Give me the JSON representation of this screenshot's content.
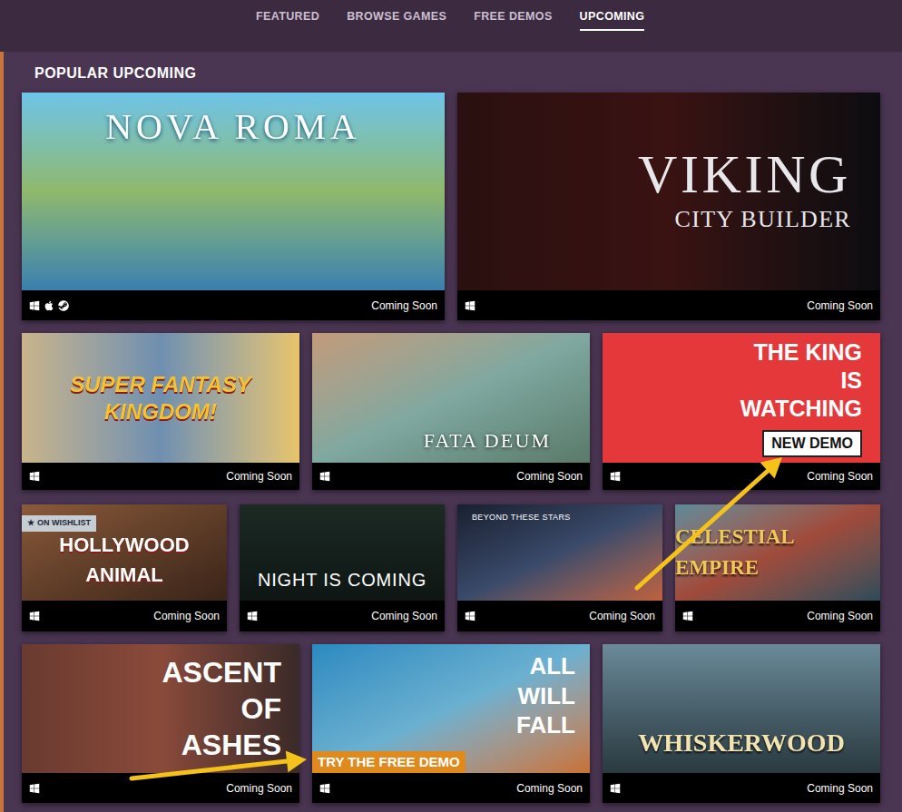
{
  "nav": {
    "tabs": [
      {
        "label": "FEATURED",
        "selected": false
      },
      {
        "label": "BROWSE GAMES",
        "selected": false
      },
      {
        "label": "FREE DEMOS",
        "selected": false
      },
      {
        "label": "UPCOMING",
        "selected": true
      }
    ]
  },
  "section": {
    "title": "POPULAR UPCOMING"
  },
  "wishlist": {
    "icon": "★",
    "label": "ON WISHLIST"
  },
  "rows": [
    [
      {
        "title": "NOVA ROMA",
        "status": "Coming Soon",
        "platforms": [
          "windows",
          "mac",
          "steam"
        ],
        "wishlisted": false
      },
      {
        "title": "VIKING",
        "subtitle": "CITY BUILDER",
        "status": "Coming Soon",
        "platforms": [
          "windows"
        ],
        "wishlisted": false
      }
    ],
    [
      {
        "title": "SUPER FANTASY KINGDOM!",
        "status": "Coming Soon",
        "platforms": [
          "windows"
        ],
        "wishlisted": false
      },
      {
        "title": "FATA DEUM",
        "status": "Coming Soon",
        "platforms": [
          "windows"
        ],
        "wishlisted": false
      },
      {
        "title": "THE KING IS WATCHING",
        "badge": "NEW DEMO",
        "status": "Coming Soon",
        "platforms": [
          "windows"
        ],
        "wishlisted": false
      }
    ],
    [
      {
        "title": "HOLLYWOOD ANIMAL",
        "status": "Coming Soon",
        "platforms": [
          "windows"
        ],
        "wishlisted": true
      },
      {
        "title": "NIGHT IS COMING",
        "status": "Coming Soon",
        "platforms": [
          "windows"
        ],
        "wishlisted": false
      },
      {
        "title": "BEYOND THESE STARS",
        "status": "Coming Soon",
        "platforms": [
          "windows"
        ],
        "wishlisted": false
      },
      {
        "title": "CELESTIAL EMPIRE",
        "status": "Coming Soon",
        "platforms": [
          "windows"
        ],
        "wishlisted": false
      }
    ],
    [
      {
        "title": "ASCENT OF ASHES",
        "status": "Coming Soon",
        "platforms": [
          "windows"
        ],
        "wishlisted": false
      },
      {
        "title": "ALL WILL FALL",
        "badge": "TRY THE FREE DEMO",
        "status": "Coming Soon",
        "platforms": [
          "windows"
        ],
        "wishlisted": false
      },
      {
        "title": "WHISKERWOOD",
        "status": "Coming Soon",
        "platforms": [
          "windows"
        ],
        "wishlisted": false
      }
    ]
  ]
}
